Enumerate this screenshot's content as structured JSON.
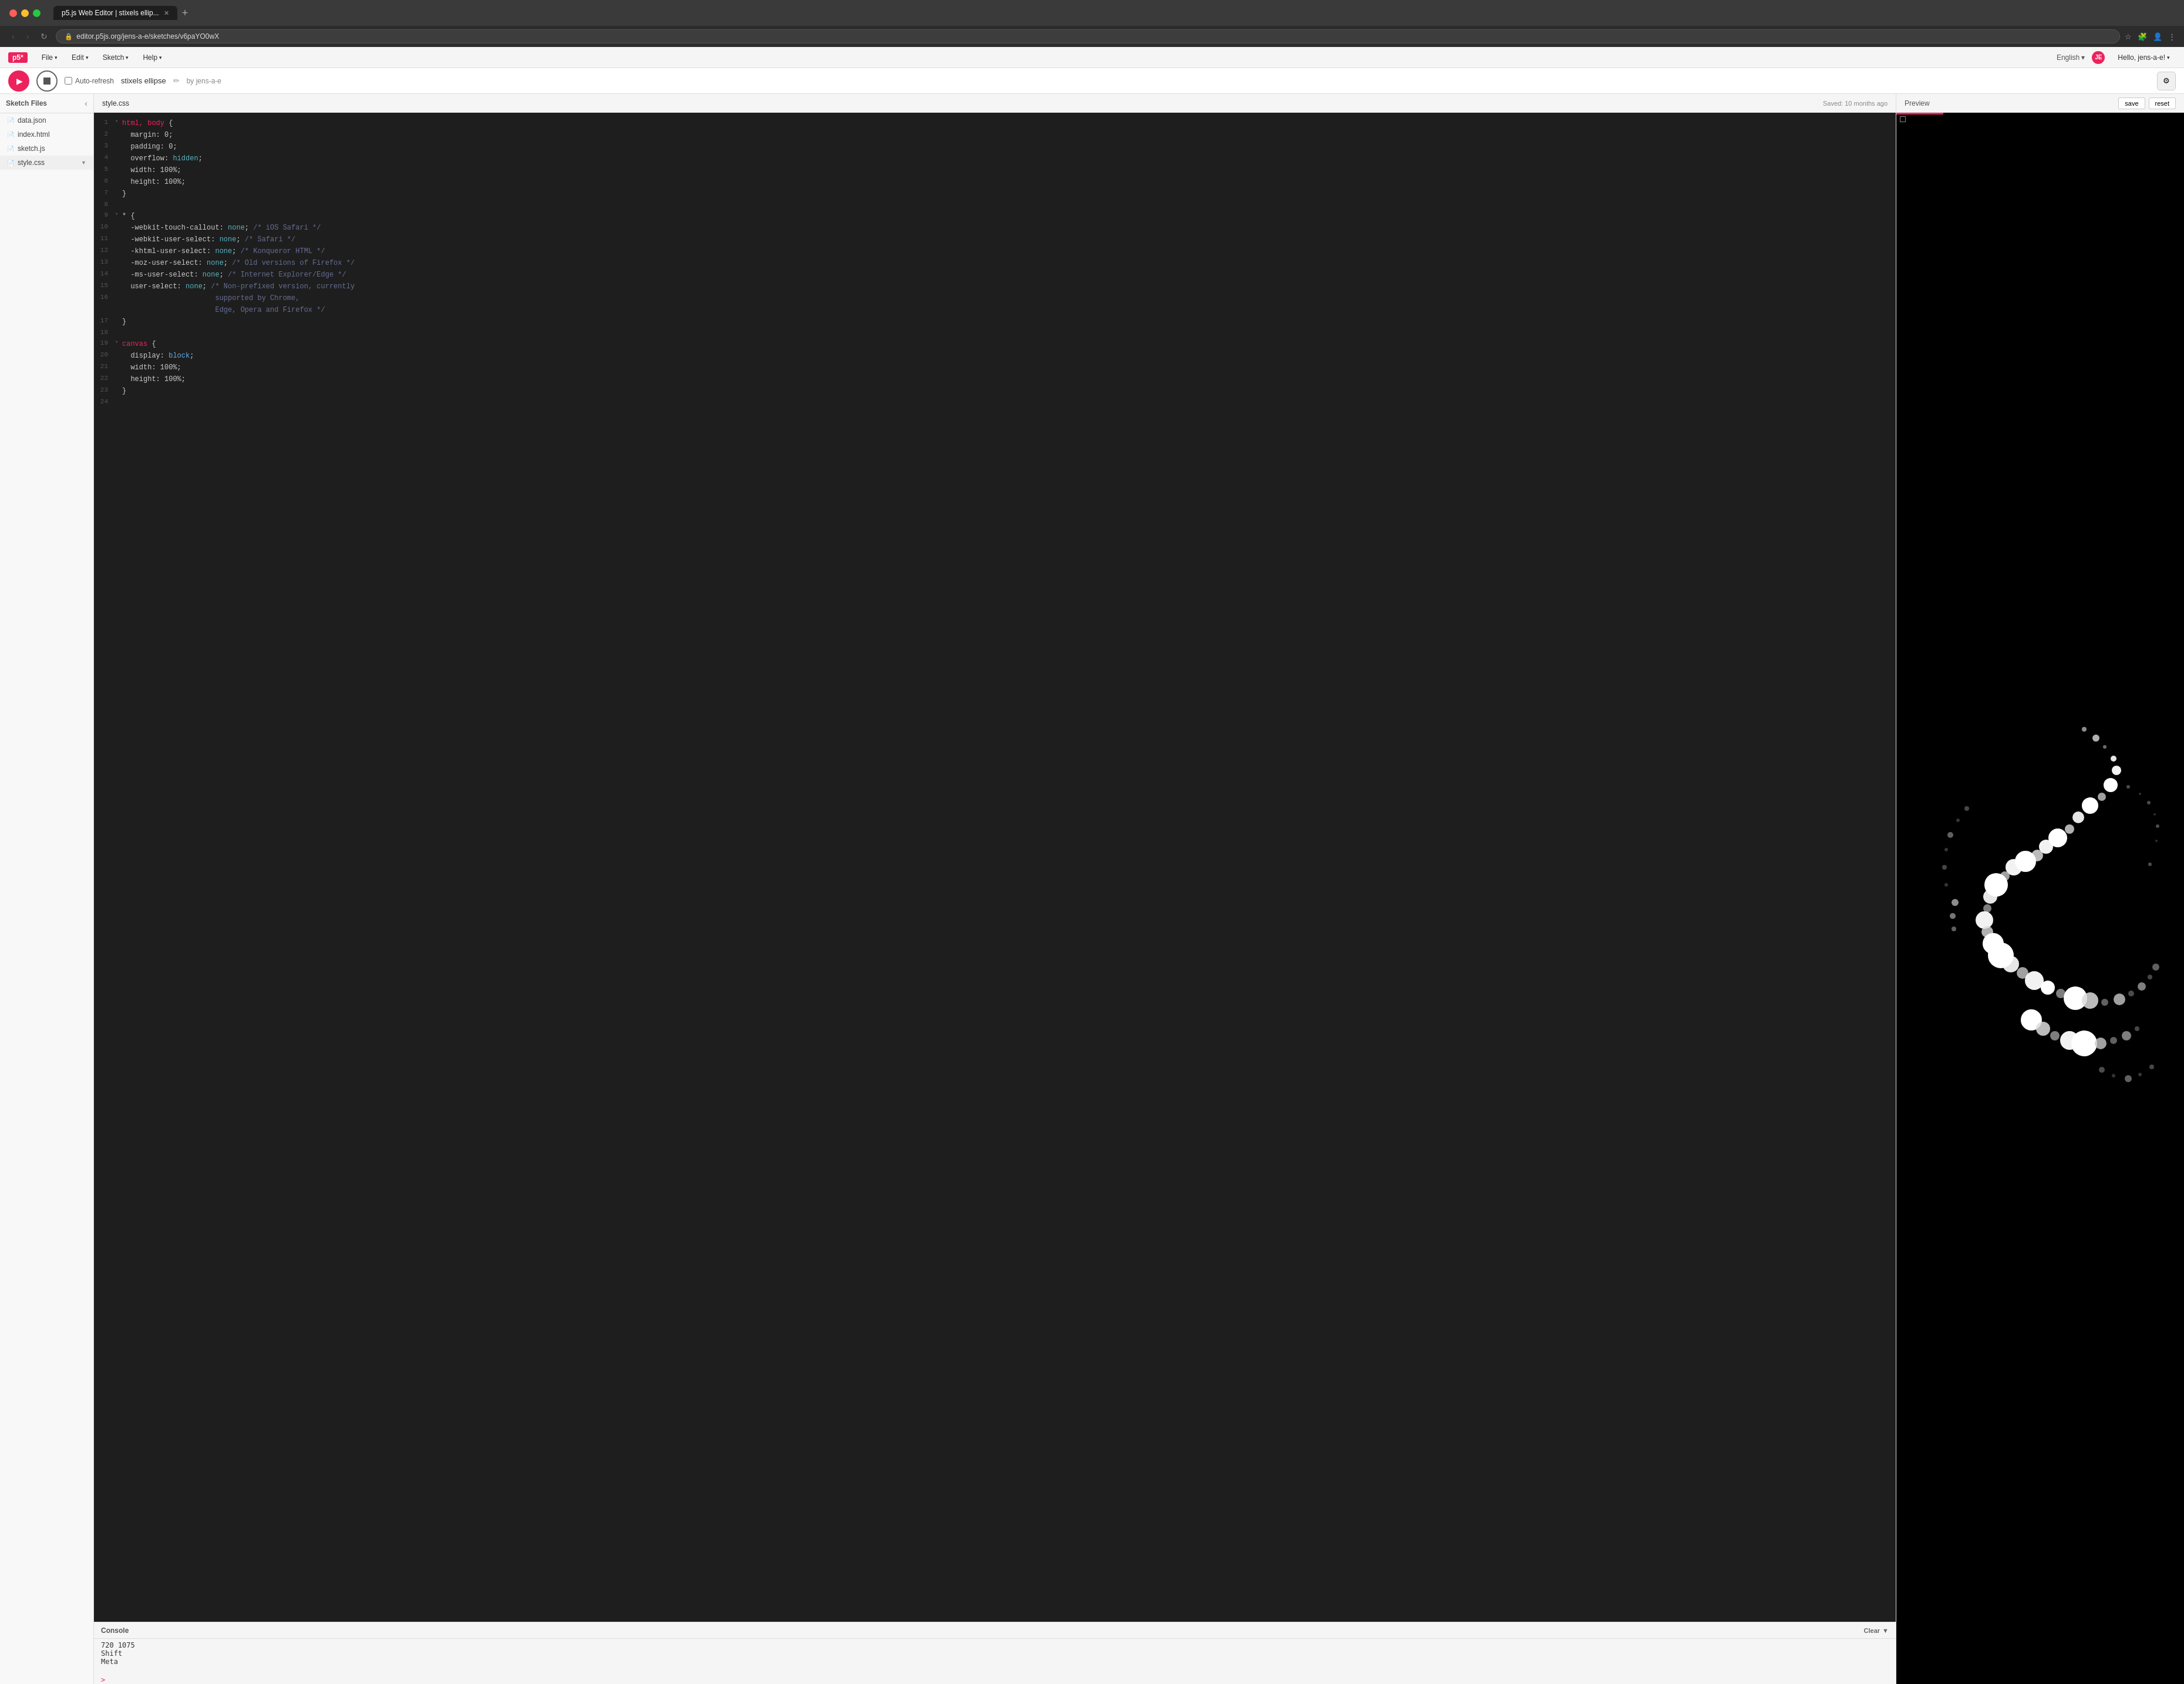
{
  "browser": {
    "tab_title": "p5.js Web Editor | stixels ellip...",
    "new_tab_btn": "+",
    "nav_back": "‹",
    "nav_fwd": "›",
    "nav_refresh": "↻",
    "address": "editor.p5js.org/jens-a-e/sketches/v6paYO0wX",
    "address_lock": "🔒"
  },
  "app": {
    "logo": "p5*",
    "menu": {
      "file": "File",
      "edit": "Edit",
      "sketch": "Sketch",
      "help": "Help"
    },
    "language": "English",
    "user_initials": "JE",
    "user_label": "Hello, jens-a-e!"
  },
  "toolbar": {
    "play_label": "▶",
    "stop_label": "■",
    "auto_refresh_label": "Auto-refresh",
    "sketch_title": "stixels ellipse",
    "sketch_edited": "✏",
    "sketch_by": "by jens-a-e",
    "settings_icon": "⚙"
  },
  "sidebar": {
    "title": "Sketch Files",
    "collapse_icon": "‹",
    "files": [
      {
        "name": "data.json",
        "icon": "📄",
        "active": false
      },
      {
        "name": "index.html",
        "icon": "📄",
        "active": false
      },
      {
        "name": "sketch.js",
        "icon": "📄",
        "active": false
      },
      {
        "name": "style.css",
        "icon": "📄",
        "active": true,
        "arrow": "▼"
      }
    ]
  },
  "editor": {
    "filename": "style.css",
    "saved_status": "Saved: 10 months ago",
    "lines": [
      {
        "num": 1,
        "fold": "▾",
        "content": "html, body {"
      },
      {
        "num": 2,
        "fold": " ",
        "content": "  margin: 0;"
      },
      {
        "num": 3,
        "fold": " ",
        "content": "  padding: 0;"
      },
      {
        "num": 4,
        "fold": " ",
        "content": "  overflow: hidden;"
      },
      {
        "num": 5,
        "fold": " ",
        "content": "  width: 100%;"
      },
      {
        "num": 6,
        "fold": " ",
        "content": "  height: 100%;"
      },
      {
        "num": 7,
        "fold": " ",
        "content": "}"
      },
      {
        "num": 8,
        "fold": " ",
        "content": ""
      },
      {
        "num": 9,
        "fold": "▾",
        "content": "* {"
      },
      {
        "num": 10,
        "fold": " ",
        "content": "  -webkit-touch-callout: none; /* iOS Safari */"
      },
      {
        "num": 11,
        "fold": " ",
        "content": "  -webkit-user-select: none; /* Safari */"
      },
      {
        "num": 12,
        "fold": " ",
        "content": "  -khtml-user-select: none; /* Konqueror HTML */"
      },
      {
        "num": 13,
        "fold": " ",
        "content": "  -moz-user-select: none; /* Old versions of Firefox */"
      },
      {
        "num": 14,
        "fold": " ",
        "content": "  -ms-user-select: none; /* Internet Explorer/Edge */"
      },
      {
        "num": 15,
        "fold": " ",
        "content": "  user-select: none; /* Non-prefixed version, currently"
      },
      {
        "num": 16,
        "fold": " ",
        "content": "                      supported by Chrome,"
      },
      {
        "num": 17,
        "fold": " ",
        "content": "}"
      },
      {
        "num": 18,
        "fold": " ",
        "content": ""
      },
      {
        "num": 19,
        "fold": "▾",
        "content": "canvas {"
      },
      {
        "num": 20,
        "fold": " ",
        "content": "  display: block;"
      },
      {
        "num": 21,
        "fold": " ",
        "content": "  width: 100%;"
      },
      {
        "num": 22,
        "fold": " ",
        "content": "  height: 100%;"
      },
      {
        "num": 23,
        "fold": " ",
        "content": "}"
      },
      {
        "num": 24,
        "fold": " ",
        "content": ""
      }
    ]
  },
  "preview": {
    "title": "Preview",
    "save_btn": "save",
    "reset_btn": "reset"
  },
  "console": {
    "title": "Console",
    "clear_btn": "Clear",
    "clear_arrow": "▼",
    "lines": [
      "720 1075",
      "Shift",
      "Meta"
    ],
    "prompt_symbol": ">"
  }
}
